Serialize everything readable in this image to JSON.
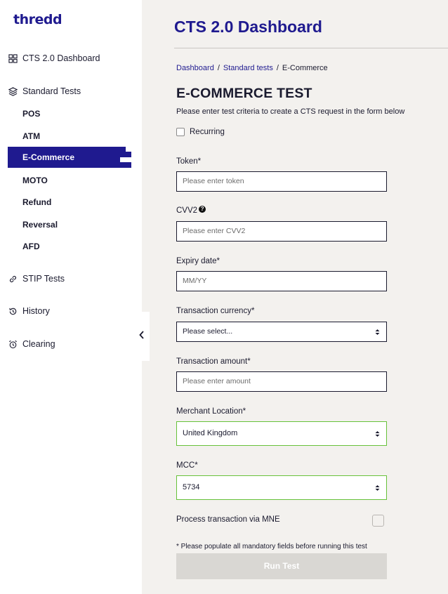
{
  "brand": {
    "logo": "thredd"
  },
  "sidebar": {
    "items": [
      {
        "label": "CTS 2.0 Dashboard",
        "icon": "dashboard-grid-icon"
      },
      {
        "label": "Standard Tests",
        "icon": "layers-icon"
      },
      {
        "label": "STIP Tests",
        "icon": "link-icon"
      },
      {
        "label": "History",
        "icon": "history-icon"
      },
      {
        "label": "Clearing",
        "icon": "alarm-clock-icon"
      }
    ],
    "subitems": [
      "POS",
      "ATM",
      "E-Commerce",
      "MOTO",
      "Refund",
      "Reversal",
      "AFD"
    ],
    "active_subitem": "E-Commerce"
  },
  "header": {
    "title": "CTS 2.0 Dashboard"
  },
  "breadcrumb": {
    "items": [
      "Dashboard",
      "Standard tests",
      "E-Commerce"
    ],
    "separator": "/"
  },
  "form": {
    "title": "E-COMMERCE TEST",
    "description": "Please enter test criteria to create a CTS request in the form below",
    "recurring_label": "Recurring",
    "token": {
      "label": "Token*",
      "placeholder": "Please enter token"
    },
    "cvv2": {
      "label": "CVV2",
      "placeholder": "Please enter CVV2"
    },
    "expiry": {
      "label": "Expiry date*",
      "placeholder": "MM/YY"
    },
    "currency": {
      "label": "Transaction currency*",
      "value": "Please select..."
    },
    "amount": {
      "label": "Transaction amount*",
      "placeholder": "Please enter amount"
    },
    "merchant_location": {
      "label": "Merchant Location*",
      "value": "United Kingdom"
    },
    "mcc": {
      "label": "MCC*",
      "value": "5734"
    },
    "mne_label": "Process transaction via MNE",
    "note": "* Please populate all mandatory fields before running this test",
    "run_button": "Run Test"
  },
  "colors": {
    "brand": "#1f1a8f",
    "valid_border": "#67c23a",
    "button_disabled": "#d9d7d3",
    "page_bg": "#f3f1ee"
  }
}
